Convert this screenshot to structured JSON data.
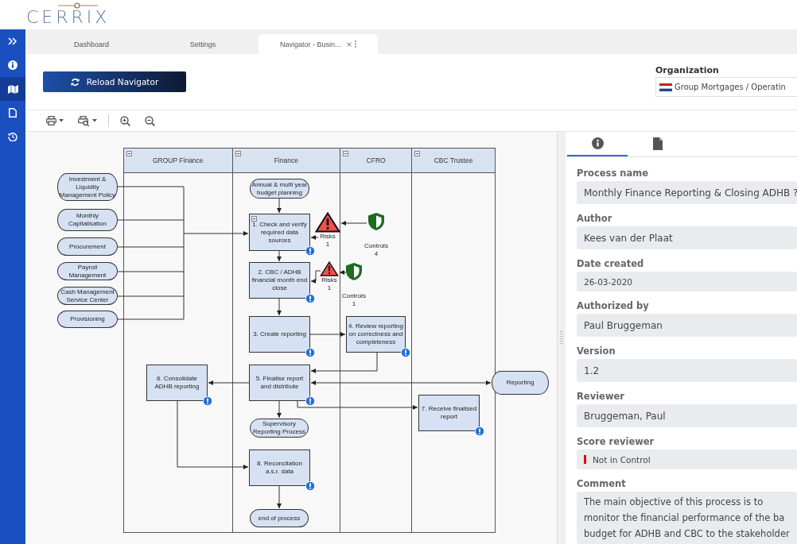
{
  "logo": {
    "text": "CERRIX"
  },
  "sidebar": {
    "items": [
      {
        "kind": "expand",
        "selected": false
      },
      {
        "kind": "info",
        "selected": false
      },
      {
        "kind": "map",
        "selected": true
      },
      {
        "kind": "file",
        "selected": false
      },
      {
        "kind": "history",
        "selected": false
      }
    ]
  },
  "tabs": [
    {
      "label": "Dashboard",
      "selected": false,
      "closable": false
    },
    {
      "label": "Settings",
      "selected": false,
      "closable": false
    },
    {
      "label": "Navigator - Busin…",
      "selected": true,
      "closable": true
    }
  ],
  "reload_button": {
    "label": "Reload Navigator"
  },
  "organization": {
    "label": "Organization",
    "value": "Group Mortgages / Operatin"
  },
  "toolbar": {
    "items": [
      {
        "kind": "print",
        "dropdown": true
      },
      {
        "kind": "print-preview",
        "dropdown": true
      },
      {
        "kind": "separator"
      },
      {
        "kind": "zoom-in",
        "dropdown": false
      },
      {
        "kind": "zoom-out",
        "dropdown": false
      }
    ]
  },
  "diagram": {
    "lanes": [
      {
        "label": "GROUP Finance"
      },
      {
        "label": "Finance"
      },
      {
        "label": "CFRO"
      },
      {
        "label": "CBC Trustee"
      }
    ],
    "nodes": [
      {
        "kind": "terminator",
        "text": "Investment & Liquidity Management Policy"
      },
      {
        "kind": "terminator",
        "text": "Monthly Capitalisation"
      },
      {
        "kind": "terminator",
        "text": "Procurement"
      },
      {
        "kind": "terminator",
        "text": "Payroll Management"
      },
      {
        "kind": "terminator",
        "text": "Cash Management Service Center"
      },
      {
        "kind": "terminator",
        "text": "Provisioning"
      },
      {
        "kind": "terminator",
        "text": "Annual & multi year budget planning"
      },
      {
        "kind": "step",
        "text": "1. Check and verify required data sources",
        "info": true,
        "collapsible": true
      },
      {
        "kind": "risk",
        "label": "Risks",
        "count": "1"
      },
      {
        "kind": "control",
        "label": "Controls",
        "count": "4"
      },
      {
        "kind": "step",
        "text": "2. CBC / ADHB financial month end close",
        "info": true,
        "collapsible": false
      },
      {
        "kind": "risk",
        "label": "Risks",
        "count": "1"
      },
      {
        "kind": "control",
        "label": "Controls",
        "count": "1"
      },
      {
        "kind": "step",
        "text": "3. Create reporting",
        "info": true,
        "collapsible": false
      },
      {
        "kind": "step",
        "text": "4. Review reporting on correctness and completeness",
        "info": true,
        "collapsible": false
      },
      {
        "kind": "step",
        "text": "6. Consolidate ADHB reporting",
        "info": true,
        "collapsible": false
      },
      {
        "kind": "step",
        "text": "5. Finalise report and distribute",
        "info": true,
        "collapsible": false
      },
      {
        "kind": "terminator",
        "text": "Reporting"
      },
      {
        "kind": "step",
        "text": "7. Receive finalised report",
        "info": true,
        "collapsible": false
      },
      {
        "kind": "terminator",
        "text": "Supervisory Reporting Process"
      },
      {
        "kind": "step",
        "text": "8. Reconcilation a.s.r. data",
        "info": true,
        "collapsible": false
      },
      {
        "kind": "terminator",
        "text": "end of process"
      }
    ]
  },
  "details": {
    "tabs": [
      {
        "kind": "info",
        "selected": true
      },
      {
        "kind": "file",
        "selected": false
      }
    ],
    "fields": [
      {
        "kind": "text",
        "label": "Process name",
        "value": "Monthly Finance Reporting & Closing ADHB ?"
      },
      {
        "kind": "text",
        "label": "Author",
        "value": "Kees van der Plaat"
      },
      {
        "kind": "date",
        "label": "Date created",
        "value": "26-03-2020"
      },
      {
        "kind": "text",
        "label": "Authorized by",
        "value": "Paul Bruggeman"
      },
      {
        "kind": "text",
        "label": "Version",
        "value": "1.2"
      },
      {
        "kind": "text",
        "label": "Reviewer",
        "value": "Bruggeman, Paul"
      },
      {
        "kind": "score",
        "label": "Score reviewer",
        "value": "Not in Control",
        "color": "#e8000b"
      },
      {
        "kind": "textarea",
        "label": "Comment",
        "lines": [
          "The main objective of this process is to",
          "monitor the financial performance of the ba",
          "budget for ADHB and CBC to the stakeholder"
        ]
      }
    ]
  }
}
